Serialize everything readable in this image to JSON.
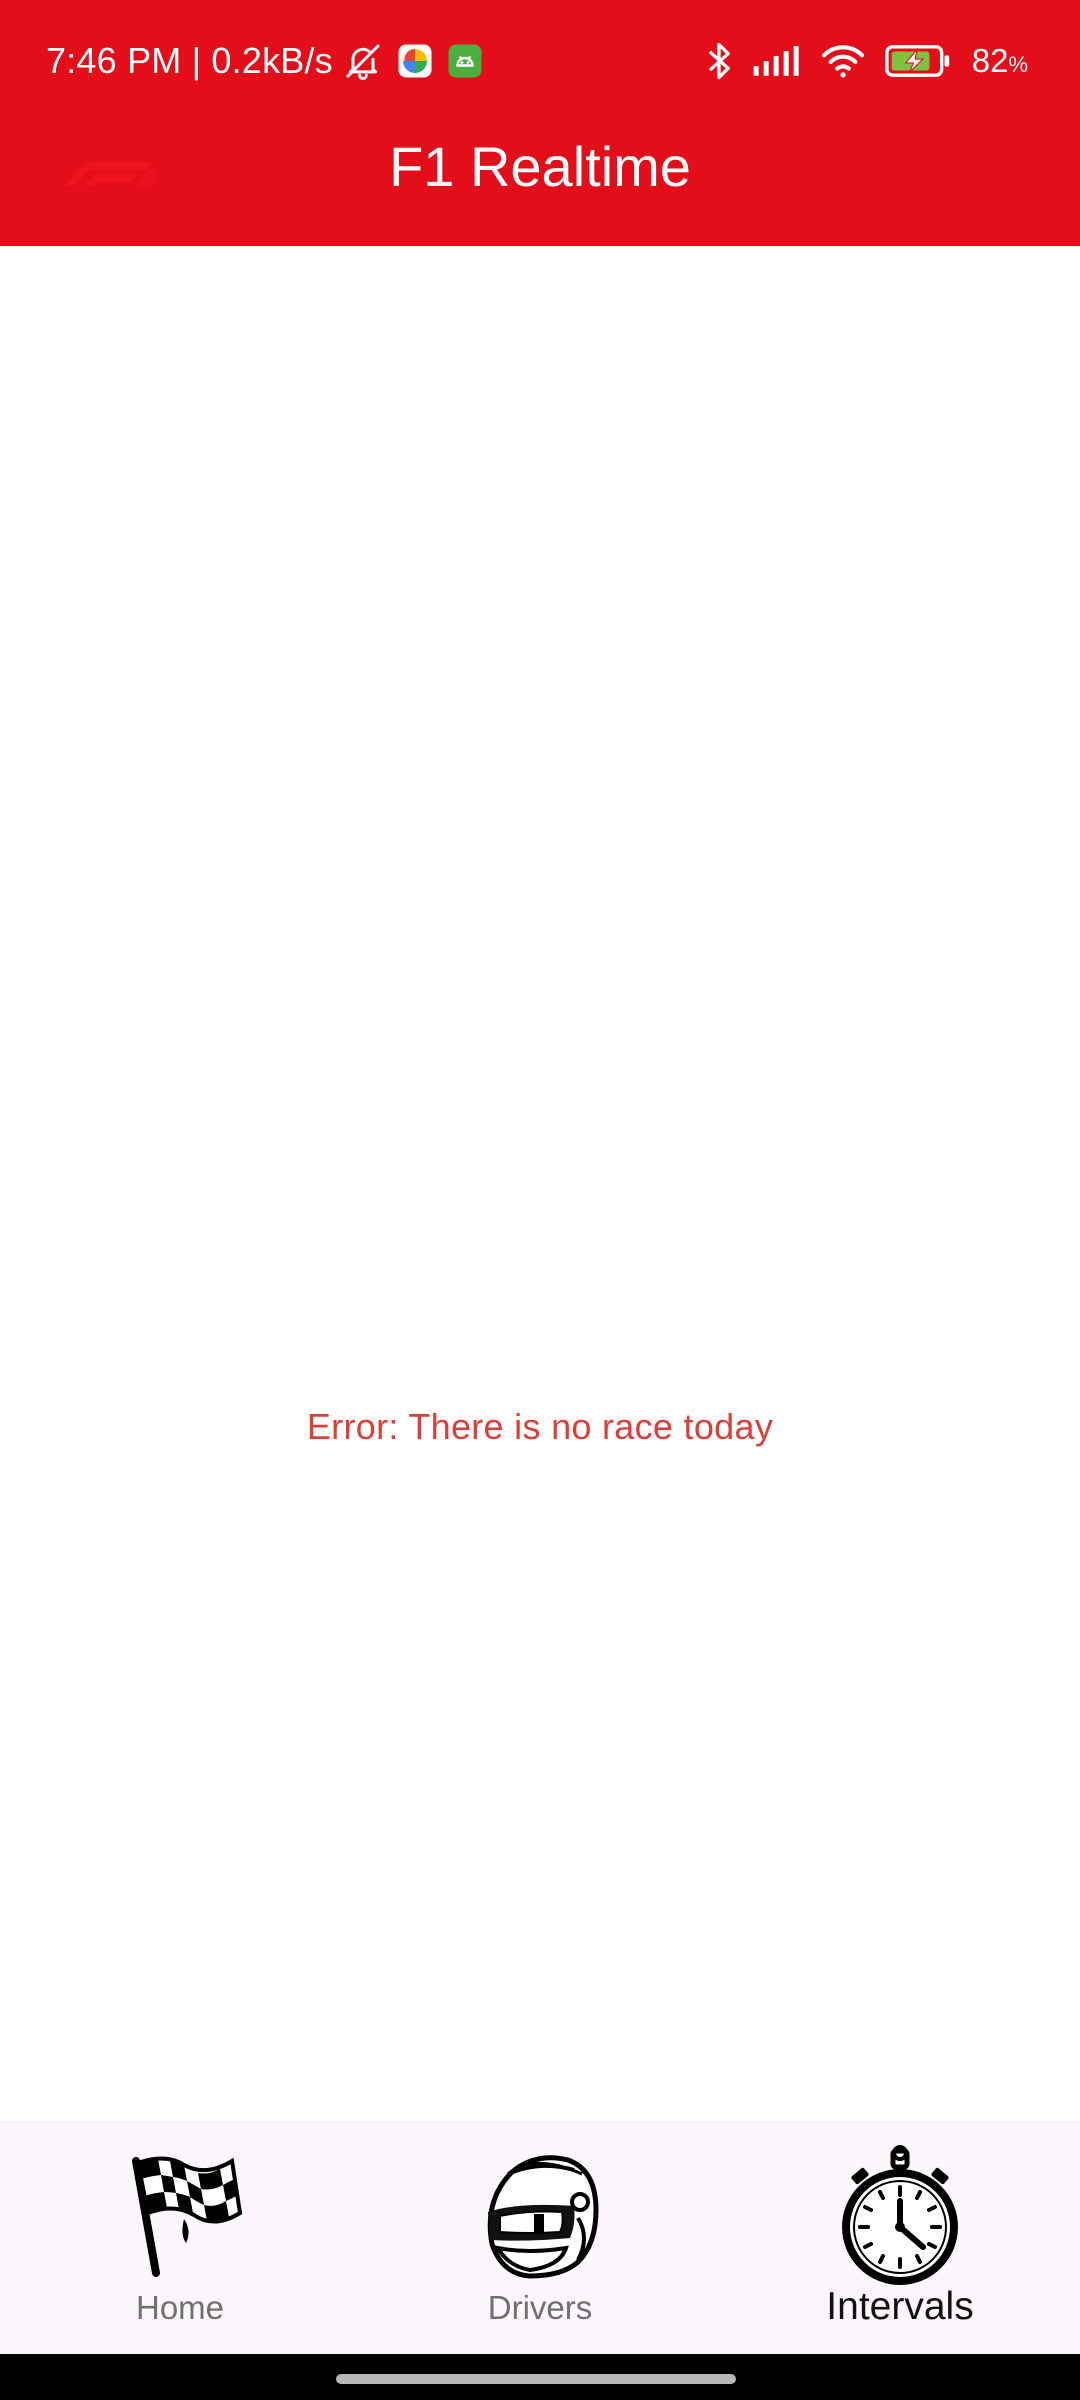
{
  "status_bar": {
    "time_speed": "7:46 PM | 0.2kB/s",
    "battery_percent": "82",
    "battery_unit": "%",
    "icons": [
      "bell-off-icon",
      "photos-app-icon",
      "android-app-icon",
      "bluetooth-icon",
      "signal-icon",
      "wifi-icon",
      "battery-charging-icon"
    ]
  },
  "app_bar": {
    "title": "F1 Realtime",
    "logo_icon": "f1-logo-icon",
    "color": "#e40e1a"
  },
  "main": {
    "error_message": "Error: There is no race today",
    "error_color": "#d9403a"
  },
  "bottom_nav": {
    "items": [
      {
        "label": "Home",
        "icon": "checkered-flag-icon",
        "active": false
      },
      {
        "label": "Drivers",
        "icon": "helmet-icon",
        "active": false
      },
      {
        "label": "Intervals",
        "icon": "stopwatch-icon",
        "active": true
      }
    ]
  }
}
